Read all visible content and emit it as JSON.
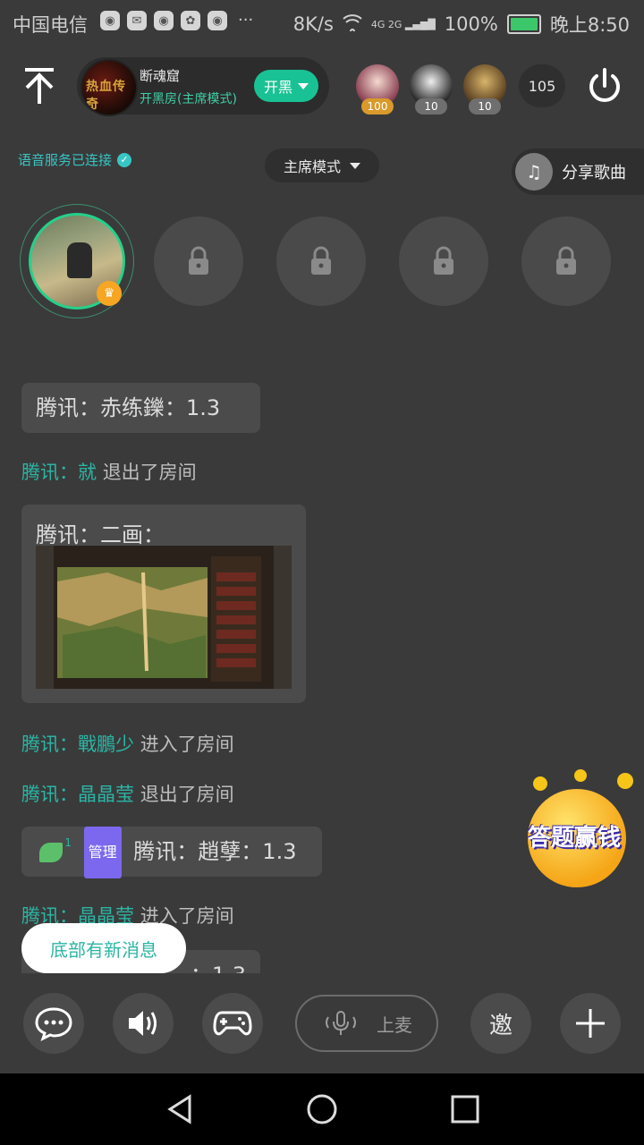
{
  "status_bar": {
    "carrier": "中国电信",
    "net_speed": "8K/s",
    "network_type": "4G 2G",
    "battery": "100%",
    "time": "晚上8:50",
    "more": "···"
  },
  "header": {
    "room_name": "断魂窟",
    "room_subtitle": "开黑房(主席模式)",
    "room_action": "开黑",
    "room_logo_text": "热血传奇",
    "audience": [
      {
        "badge": "100",
        "badge_color": "#d99a2b"
      },
      {
        "badge": "10",
        "badge_color": "#6f6f6f"
      },
      {
        "badge": "10",
        "badge_color": "#6f6f6f"
      }
    ],
    "audience_count": "105"
  },
  "voice_status": "语音服务已连接",
  "mode_label": "主席模式",
  "share_song": "分享歌曲",
  "messages": {
    "m1_text": "腾讯：赤练鑠：1.3",
    "m2_tag": "腾讯：",
    "m2_user": "就",
    "m2_action": "退出了房间",
    "m3_text": "腾讯：二画：",
    "m4_tag": "腾讯：",
    "m4_user": "戰鵬少",
    "m4_action": "进入了房间",
    "m5_tag": "腾讯：",
    "m5_user": "晶晶莹",
    "m5_action": "退出了房间",
    "m6_level": "1",
    "m6_admin": "管理",
    "m6_text": "腾讯：趙孽：1.3",
    "m7_tag": "腾讯：",
    "m7_user": "晶晶莹",
    "m7_action": "进入了房间",
    "m8_partial": "：1.3"
  },
  "toast": "底部有新消息",
  "promo": "答题赢钱",
  "toolbar": {
    "mic_label": "上麦",
    "invite_label": "邀"
  },
  "colors": {
    "accent": "#19c294",
    "tag": "#2bb5a3",
    "background": "#3a3a3b"
  }
}
